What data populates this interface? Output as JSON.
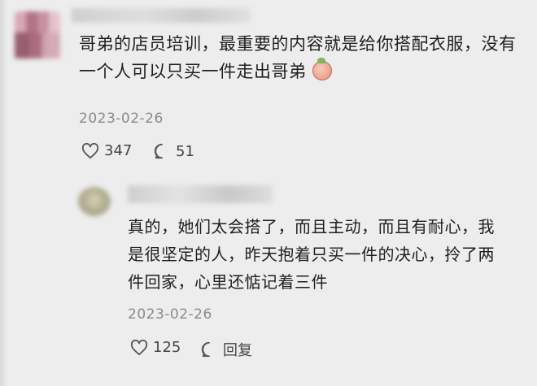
{
  "comment": {
    "text": "哥弟的店员培训，最重要的内容就是给你搭配衣服，没有一个人可以只买一件走出哥弟",
    "date": "2023-02-26",
    "likes": "347",
    "comments": "51",
    "emoji_icon": "peach-emoji-icon"
  },
  "reply": {
    "text": "真的，她们太会搭了，而且主动，而且有耐心，我是很坚定的人，昨天抱着只买一件的决心，拎了两件回家，心里还惦记着三件",
    "date": "2023-02-26",
    "likes": "125",
    "reply_label": "回复"
  },
  "colors": {
    "background": "#ededed",
    "text": "#1f1f1f",
    "meta": "#8a8a8a"
  }
}
